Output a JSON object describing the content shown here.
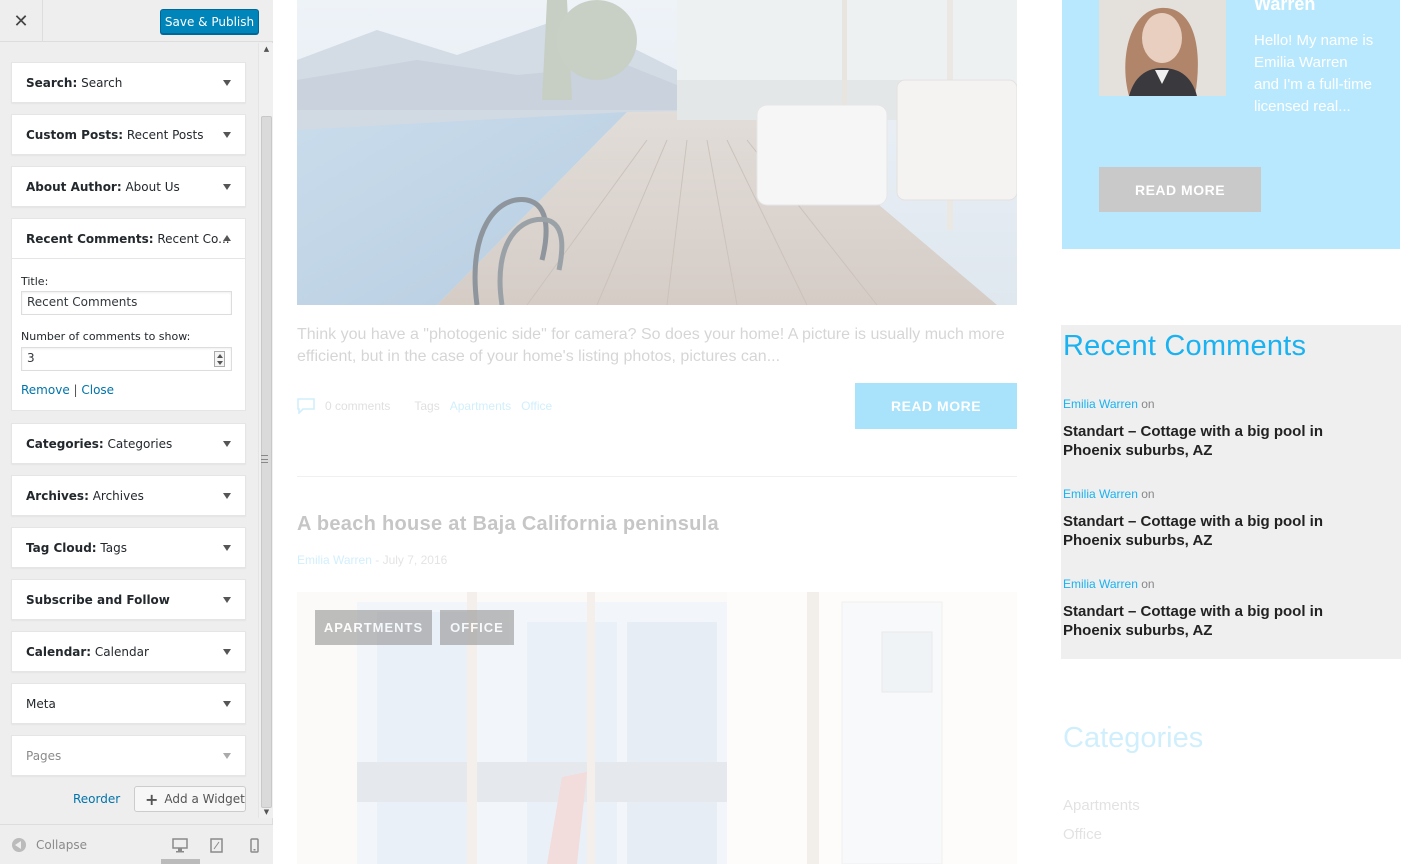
{
  "customizer": {
    "close_glyph": "✕",
    "publish_label": "Save & Publish",
    "widgets_top": [
      {
        "name": "Search:",
        "title": " Search"
      },
      {
        "name": "Custom Posts:",
        "title": " Recent Posts"
      },
      {
        "name": "About Author:",
        "title": " About Us"
      }
    ],
    "open_widget": {
      "name": "Recent Comments:",
      "title": " Recent Co...",
      "title_label": "Title:",
      "title_value": "Recent Comments",
      "count_label": "Number of comments to show:",
      "count_value": "3",
      "remove_label": "Remove",
      "separator": " | ",
      "close_label": "Close"
    },
    "widgets_bottom": [
      {
        "name": "Categories:",
        "title": " Categories"
      },
      {
        "name": "Archives:",
        "title": " Archives"
      },
      {
        "name": "Tag Cloud:",
        "title": " Tags"
      },
      {
        "name": "Subscribe and Follow",
        "title": ""
      },
      {
        "name": "Calendar:",
        "title": " Calendar"
      },
      {
        "name": "Meta",
        "title": ""
      },
      {
        "name": "Pages",
        "title": ""
      }
    ],
    "reorder_label": "Reorder",
    "add_widget_label": "Add a Widget",
    "collapse_label": "Collapse"
  },
  "preview": {
    "excerpt": "Think you have a \"photogenic side\" for camera? So does your home! A picture is usually much more efficient, but in the case of your home's listing photos, pictures can...",
    "comments_count": "0 comments",
    "tags_label": "Tags",
    "tags": [
      "Apartments",
      "Office"
    ],
    "read_more": "READ MORE",
    "post2_title": "A beach house at Baja California peninsula",
    "post2_author": "Emilia Warren",
    "post2_sep": " - ",
    "post2_date": "July 7, 2016",
    "badges": [
      "APARTMENTS",
      "OFFICE"
    ],
    "author_box": {
      "name": "Warren",
      "bio": "Hello! My name is Emilia Warren and I'm a full-time licensed real...",
      "button": "READ MORE"
    },
    "recent_comments": {
      "title": "Recent Comments",
      "items": [
        {
          "author": "Emilia Warren",
          "on": " on",
          "post": "Standart – Cottage with a big pool in Phoenix suburbs, AZ"
        },
        {
          "author": "Emilia Warren",
          "on": " on",
          "post": "Standart – Cottage with a big pool in Phoenix suburbs, AZ"
        },
        {
          "author": "Emilia Warren",
          "on": " on",
          "post": "Standart – Cottage with a big pool in Phoenix suburbs, AZ"
        }
      ]
    },
    "categories": {
      "title": "Categories",
      "items": [
        "Apartments",
        "Office"
      ]
    }
  },
  "colors": {
    "accent": "#1ab2f1",
    "publish": "#0085ba",
    "link": "#0073aa"
  }
}
